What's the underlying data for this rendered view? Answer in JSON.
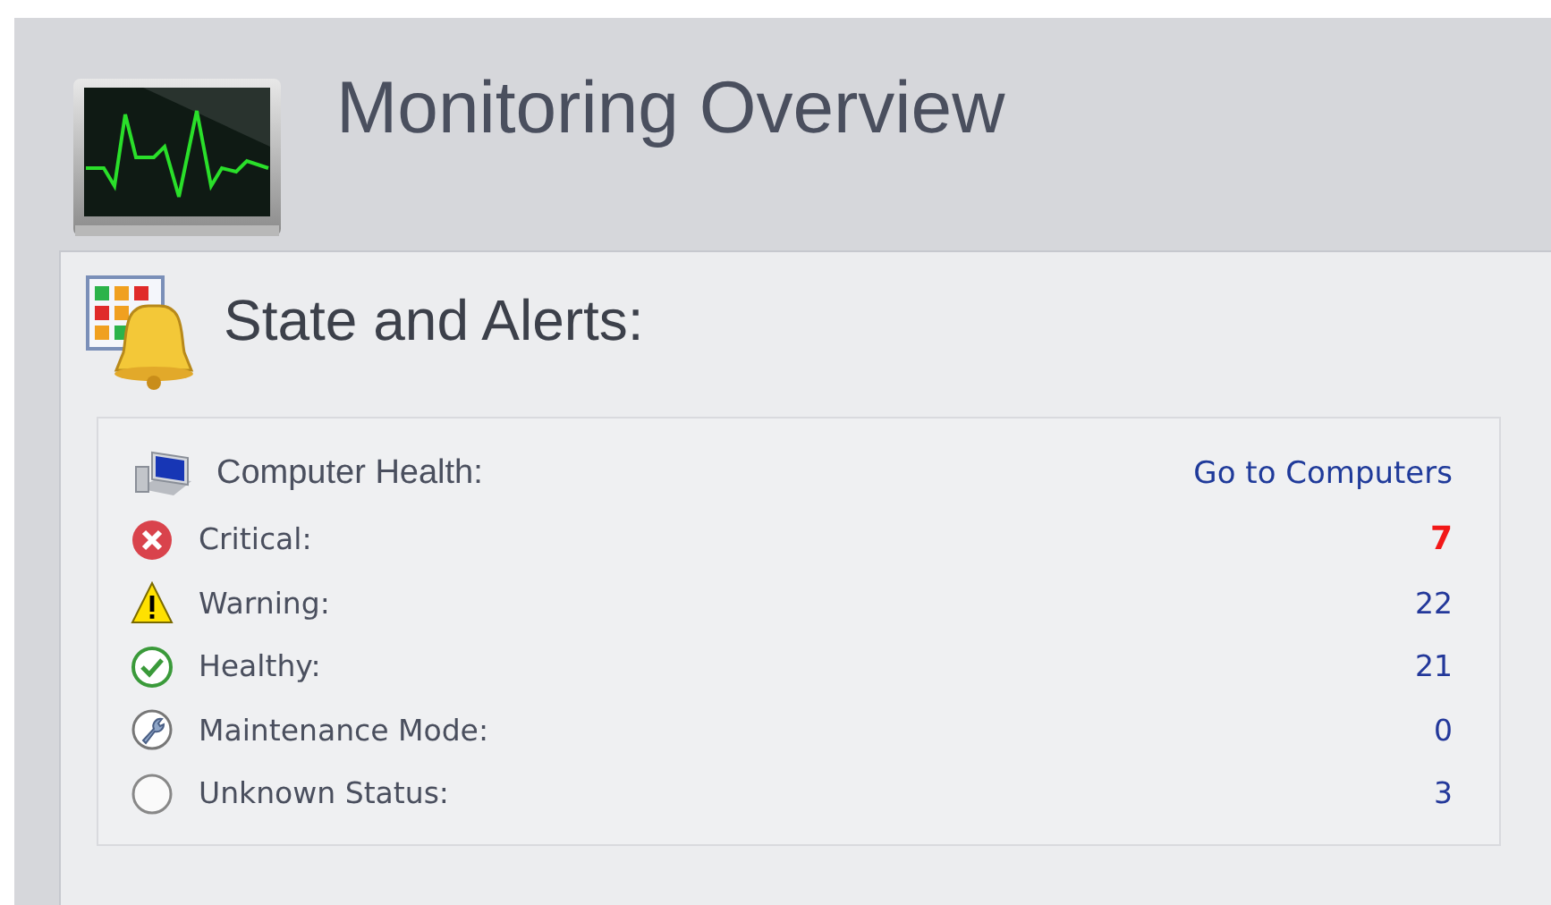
{
  "page": {
    "title": "Monitoring Overview"
  },
  "section": {
    "title": "State and Alerts:",
    "health": {
      "title": "Computer Health:",
      "link": "Go to Computers",
      "rows": [
        {
          "kind": "critical",
          "label": "Critical:",
          "value": "7",
          "emphasized": true
        },
        {
          "kind": "warning",
          "label": "Warning:",
          "value": "22",
          "emphasized": false
        },
        {
          "kind": "healthy",
          "label": "Healthy:",
          "value": "21",
          "emphasized": false
        },
        {
          "kind": "maintenance",
          "label": "Maintenance Mode:",
          "value": "0",
          "emphasized": false
        },
        {
          "kind": "unknown",
          "label": "Unknown Status:",
          "value": "3",
          "emphasized": false
        }
      ]
    }
  }
}
